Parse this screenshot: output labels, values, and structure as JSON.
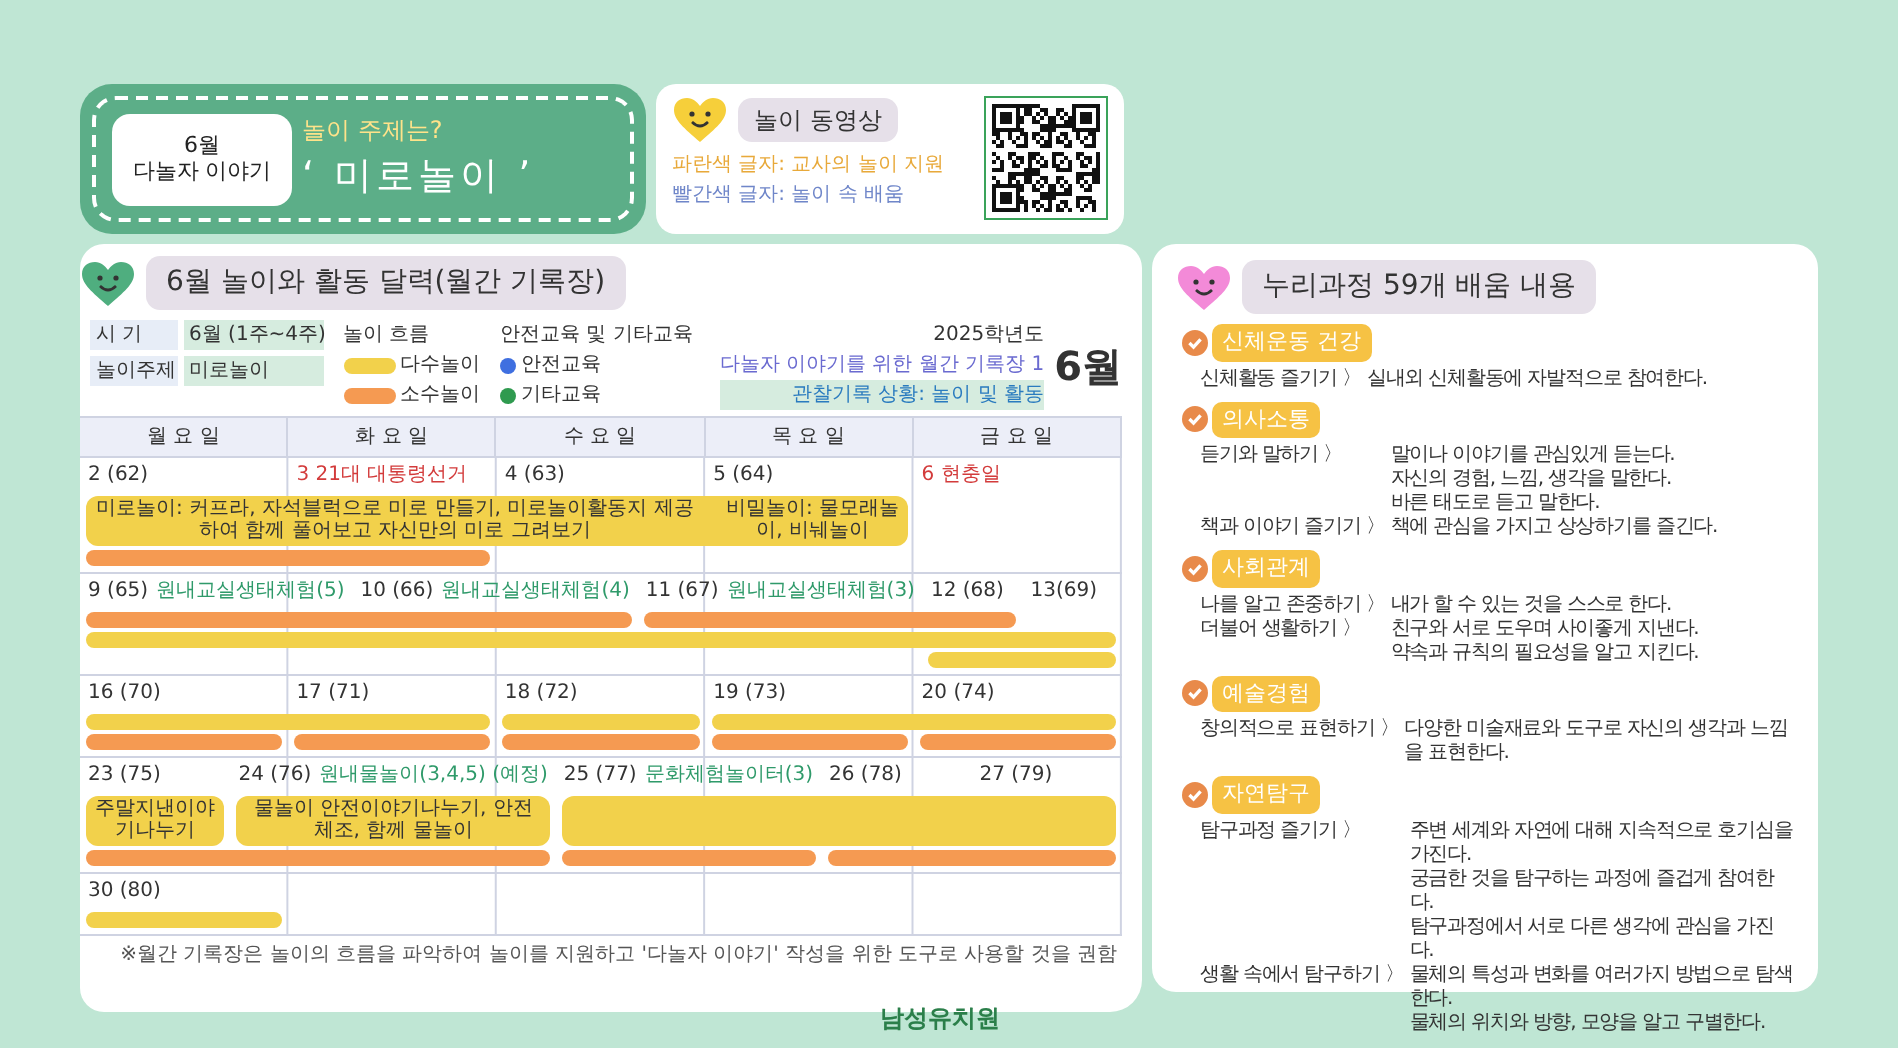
{
  "banner": {
    "month": "6월",
    "series": "다놀자 이야기",
    "question": "놀이 주제는?",
    "theme": "‘ 미로놀이 ’"
  },
  "video": {
    "title": "놀이 동영상",
    "legend": [
      {
        "text": "파란색 글자: 교사의 놀이 지원",
        "color": "#e8a93a"
      },
      {
        "text": "빨간색 글자: 놀이 속 배움",
        "color": "#6f86c9"
      }
    ]
  },
  "calendar": {
    "title": "6월 놀이와 활동 달력(월간 기록장)",
    "info": [
      {
        "label": "시 기",
        "value": "6월 (1주~4주)"
      },
      {
        "label": "놀이주제",
        "value": "미로놀이"
      }
    ],
    "flow_title": "놀이 흐름",
    "flow": [
      {
        "kind": "many",
        "label": "다수놀이"
      },
      {
        "kind": "few",
        "label": "소수놀이"
      }
    ],
    "edu_title": "안전교육 및 기타교육",
    "edu": [
      {
        "label": "안전교육",
        "color": "#3f6fe0"
      },
      {
        "label": "기타교육",
        "color": "#2f9a4f"
      }
    ],
    "heading": {
      "year": "2025학년도",
      "subtitle": "다놀자 이야기를 위한 월간 기록장 1",
      "status": "관찰기록 상황: 놀이 및 활동",
      "month": "6월"
    },
    "weekdays": [
      "월 요 일",
      "화 요 일",
      "수 요 일",
      "목 요 일",
      "금 요 일"
    ],
    "weeks": [
      {
        "days": [
          {
            "date": "2 (62)",
            "holiday": false
          },
          {
            "date": "3 21대 대통령선거",
            "holiday": true
          },
          {
            "date": "4 (63)",
            "holiday": false
          },
          {
            "date": "5 (64)",
            "holiday": false
          },
          {
            "date": "6 현충일",
            "holiday": true
          }
        ],
        "bars": [
          {
            "kind": "many",
            "texts": [
              "미로놀이: 커프라, 자석블럭으로 미로 만들기, 미로놀이활동지 제공하여 함께 풀어보고 자신만의 미로 그려보기",
              "비밀놀이: 물모래놀이, 비눼놀이"
            ]
          },
          {
            "kind": "few"
          }
        ]
      },
      {
        "days": [
          {
            "date": "9 (65)",
            "holiday": false,
            "note": "원내교실생태체험(5)"
          },
          {
            "date": "10 (66)",
            "holiday": false,
            "note": "원내교실생태체험(4)"
          },
          {
            "date": "11 (67)",
            "holiday": false,
            "note": "원내교실생태체험(3)"
          },
          {
            "date": "12 (68)",
            "holiday": false
          },
          {
            "date": "13(69)",
            "holiday": false
          }
        ],
        "bars": [
          {
            "kind": "few"
          },
          {
            "kind": "few"
          },
          {
            "kind": "many"
          },
          {
            "kind": "many"
          }
        ]
      },
      {
        "days": [
          {
            "date": "16 (70)",
            "holiday": false
          },
          {
            "date": "17 (71)",
            "holiday": false
          },
          {
            "date": "18 (72)",
            "holiday": false
          },
          {
            "date": "19 (73)",
            "holiday": false
          },
          {
            "date": "20 (74)",
            "holiday": false
          }
        ],
        "bars": [
          {
            "kind": "many"
          },
          {
            "kind": "many"
          },
          {
            "kind": "many"
          },
          {
            "kind": "few"
          },
          {
            "kind": "few"
          },
          {
            "kind": "few"
          },
          {
            "kind": "few"
          },
          {
            "kind": "few"
          }
        ]
      },
      {
        "days": [
          {
            "date": "23 (75)",
            "holiday": false
          },
          {
            "date": "24 (76)",
            "holiday": false,
            "note": "원내물놀이(3,4,5) (예정)"
          },
          {
            "date": "25 (77)",
            "holiday": false,
            "note": "문화체험놀이터(3)"
          },
          {
            "date": "26 (78)",
            "holiday": false
          },
          {
            "date": "27 (79)",
            "holiday": false
          }
        ],
        "bars": [
          {
            "kind": "many",
            "texts": [
              "주말지낸이야기나누기"
            ]
          },
          {
            "kind": "many",
            "texts": [
              "물놀이 안전이야기나누기, 안전체조, 함께 물놀이"
            ]
          },
          {
            "kind": "many"
          },
          {
            "kind": "few"
          },
          {
            "kind": "few"
          },
          {
            "kind": "few"
          }
        ]
      },
      {
        "days": [
          {
            "date": "30 (80)",
            "holiday": false
          }
        ],
        "bars": [
          {
            "kind": "many"
          }
        ]
      }
    ],
    "footer_note": "※월간 기록장은 놀이의 흐름을 파악하여 놀이를 지원하고 '다놀자 이야기' 작성을 위한 도구로 사용할 것을 권함"
  },
  "curriculum": {
    "title": "누리과정 59개 배움 내용",
    "areas": [
      {
        "name": "신체운동 건강",
        "lines": [
          {
            "head": "신체활동 즐기기 〉",
            "text": "실내외 신체활동에 자발적으로 참여한다."
          }
        ]
      },
      {
        "name": "의사소통",
        "lines": [
          {
            "head": "듣기와 말하기 〉",
            "text": "말이나 이야기를 관심있게 듣는다."
          },
          {
            "text": "자신의 경험, 느낌, 생각을 말한다."
          },
          {
            "text": "바른 태도로 듣고 말한다."
          },
          {
            "head": "책과 이야기 즐기기 〉",
            "text": "책에 관심을 가지고 상상하기를 즐긴다."
          }
        ]
      },
      {
        "name": "사회관계",
        "lines": [
          {
            "head": "나를 알고 존중하기 〉",
            "text": "내가 할 수 있는 것을 스스로 한다."
          },
          {
            "head": "더불어 생활하기 〉",
            "text": "친구와 서로 도우며 사이좋게 지낸다."
          },
          {
            "text": "약속과 규칙의 필요성을 알고 지킨다."
          }
        ]
      },
      {
        "name": "예술경험",
        "lines": [
          {
            "head": "창의적으로 표현하기 〉",
            "text": "다양한 미술재료와 도구로 자신의 생각과 느낌을 표현한다."
          }
        ]
      },
      {
        "name": "자연탐구",
        "lines": [
          {
            "head": "탐구과정 즐기기 〉",
            "text": "주변 세계와 자연에 대해 지속적으로 호기심을 가진다."
          },
          {
            "text": "궁금한 것을 탐구하는 과정에 즐겁게 참여한다."
          },
          {
            "text": "탐구과정에서 서로 다른 생각에 관심을 가진다."
          },
          {
            "head": "생활 속에서 탐구하기 〉",
            "text": "물체의 특성과 변화를 여러가지 방법으로 탐색한다."
          },
          {
            "text": "물체의 위치와 방향, 모양을 알고 구별한다."
          }
        ]
      }
    ]
  },
  "school": {
    "name": "남성유치원"
  }
}
